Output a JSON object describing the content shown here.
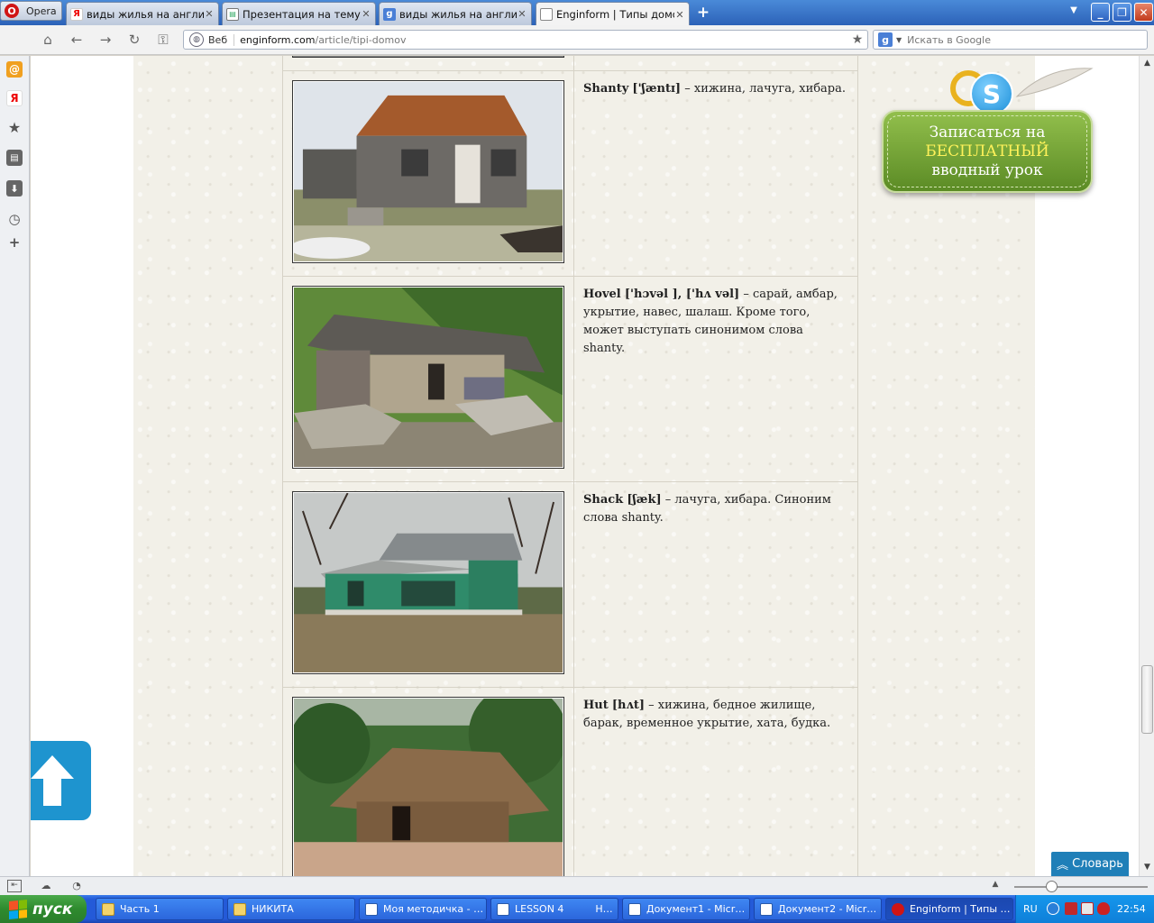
{
  "browser": {
    "menu_label": "Opera",
    "tabs": [
      {
        "label": "виды жилья на английс…",
        "icon": "yandex-icon"
      },
      {
        "label": "Презентация на тему \"…",
        "icon": "presentation-icon"
      },
      {
        "label": "виды жилья на английс…",
        "icon": "google-icon"
      },
      {
        "label": "Enginform | Типы домов",
        "icon": "page-icon",
        "active": true
      }
    ],
    "address": {
      "web_label": "Веб",
      "host": "enginform.com",
      "path": "/article/tipi-domov"
    },
    "search": {
      "placeholder": "Искать в Google"
    }
  },
  "page": {
    "entries": [
      {
        "term": "Shanty",
        "transcription": "['ʃæntɪ]",
        "definition": " – хижина, лачуга, хибара.",
        "photo": "shanty-photo"
      },
      {
        "term": "Hovel",
        "transcription": "['hɔvəl ], ['hʌ vəl]",
        "definition": " – сарай, амбар, укрытие, навес, шалаш. Кроме того, может выступать синонимом слова shanty.",
        "photo": "hovel-photo"
      },
      {
        "term": "Shack",
        "transcription": "[ʃæk]",
        "definition": " – лачуга, хибара. Синоним слова shanty.",
        "photo": "shack-photo"
      },
      {
        "term": "Hut",
        "transcription": "[hʌt]",
        "definition": " – хижина, бедное жилище, барак, временное укрытие, хата, будка.",
        "photo": "hut-photo"
      }
    ],
    "promo": {
      "line1": "Записаться на",
      "line2": "БЕСПЛАТНЫЙ",
      "line3": "вводный урок"
    },
    "dictionary_button": "Словарь"
  },
  "taskbar": {
    "start_label": "пуск",
    "items": [
      {
        "label": "Часть 1",
        "icon": "folder"
      },
      {
        "label": "НИКИТА",
        "icon": "folder"
      },
      {
        "label": "Моя методичка - …",
        "icon": "word"
      },
      {
        "label": "LESSON 4          Н…",
        "icon": "word"
      },
      {
        "label": "Документ1 - Micr…",
        "icon": "word"
      },
      {
        "label": "Документ2 - Micr…",
        "icon": "word"
      },
      {
        "label": "Enginform | Типы …",
        "icon": "opera",
        "active": true
      }
    ],
    "lang": "RU",
    "clock": "22:54"
  },
  "colors": {
    "accent_green": "#6f9e33",
    "promo_highlight": "#fff25a",
    "dict_blue": "#1f7fb8",
    "scroll_top_blue": "#1e94cf"
  }
}
